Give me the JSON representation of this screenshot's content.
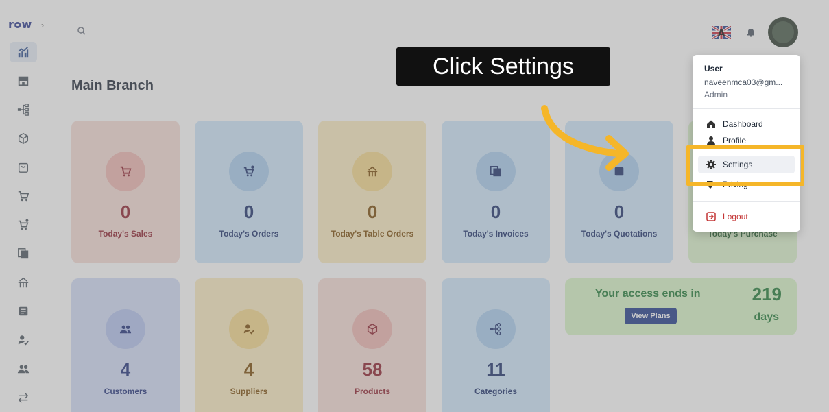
{
  "sidebar": {
    "logo": "rᴑw",
    "collapse_icon": "chevron-right-icon",
    "items": [
      {
        "icon": "chart-icon"
      },
      {
        "icon": "store-icon"
      },
      {
        "icon": "hierarchy-icon"
      },
      {
        "icon": "cube-icon"
      },
      {
        "icon": "shopping-bag-icon"
      },
      {
        "icon": "cart-icon"
      },
      {
        "icon": "cart-plus-icon"
      },
      {
        "icon": "copy-icon"
      },
      {
        "icon": "table-icon"
      },
      {
        "icon": "document-icon"
      },
      {
        "icon": "user-check-icon"
      },
      {
        "icon": "users-icon"
      },
      {
        "icon": "transfer-icon"
      }
    ]
  },
  "header": {
    "search_icon": "search-icon",
    "flag_icon": "uk-flag-icon",
    "bell_icon": "bell-icon"
  },
  "page_title": "Main Branch",
  "stats": [
    {
      "value": "0",
      "label": "Today's Sales",
      "bg": "#f6dcd6",
      "circle": "#f0b7b1",
      "color": "#8d1c2a",
      "icon": "cart-icon"
    },
    {
      "value": "0",
      "label": "Today's Orders",
      "bg": "#cfe7fb",
      "circle": "#a9cdf0",
      "color": "#1a2f6b",
      "icon": "cart-plus-icon"
    },
    {
      "value": "0",
      "label": "Today's Table Orders",
      "bg": "#fcecc2",
      "circle": "#f6d98c",
      "color": "#7a4a06",
      "icon": "table-icon"
    },
    {
      "value": "0",
      "label": "Today's Invoices",
      "bg": "#cfe7fb",
      "circle": "#a9cdf0",
      "color": "#1a2f6b",
      "icon": "copy-icon"
    },
    {
      "value": "0",
      "label": "Today's Quotations",
      "bg": "#cfe7fb",
      "circle": "#a9cdf0",
      "color": "#1a2f6b",
      "icon": "document-icon"
    },
    {
      "value": "",
      "label": "Today's Purchase",
      "bg": "#dcf5cd",
      "circle": "#bfe9a6",
      "color": "#1f5d2a",
      "icon": "cart-icon"
    },
    {
      "value": "4",
      "label": "Customers",
      "bg": "#d3ddf9",
      "circle": "#b4c3ef",
      "color": "#1e2f7a",
      "icon": "users-icon"
    },
    {
      "value": "4",
      "label": "Suppliers",
      "bg": "#fcecc2",
      "circle": "#f6d98c",
      "color": "#7a4a06",
      "icon": "user-check-icon"
    },
    {
      "value": "58",
      "label": "Products",
      "bg": "#f6dcd6",
      "circle": "#f0b7b1",
      "color": "#8d1c2a",
      "icon": "cube-icon"
    },
    {
      "value": "11",
      "label": "Categories",
      "bg": "#cfe7fb",
      "circle": "#a9cdf0",
      "color": "#1a2f6b",
      "icon": "hierarchy-icon"
    }
  ],
  "access": {
    "message": "Your access ends in",
    "days_value": "219",
    "days_label": "days",
    "button": "View Plans"
  },
  "dropdown": {
    "title": "User",
    "email": "naveenmca03@gm...",
    "role": "Admin",
    "items": [
      {
        "label": "Dashboard",
        "icon": "home-icon"
      },
      {
        "label": "Profile",
        "icon": "person-icon"
      },
      {
        "label": "Settings",
        "icon": "gear-icon"
      },
      {
        "label": "Pricing",
        "icon": "tag-icon"
      }
    ],
    "logout": "Logout"
  },
  "callout": "Click Settings",
  "highlight_color": "#f5b629"
}
